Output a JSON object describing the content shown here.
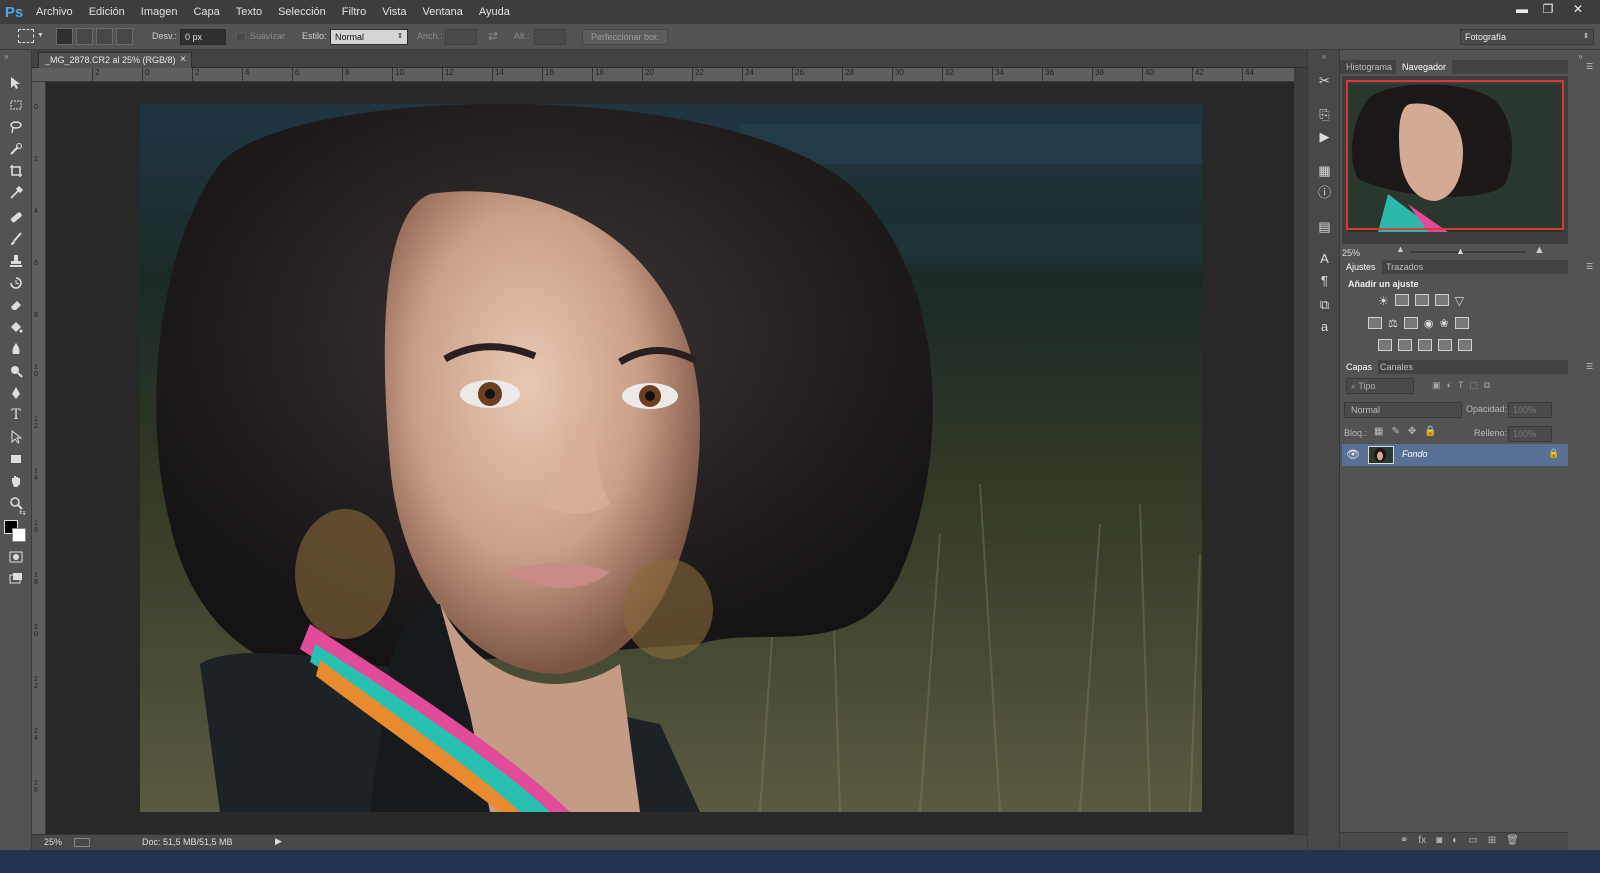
{
  "app": {
    "logo": "Ps"
  },
  "menu": [
    "Archivo",
    "Edición",
    "Imagen",
    "Capa",
    "Texto",
    "Selección",
    "Filtro",
    "Vista",
    "Ventana",
    "Ayuda"
  ],
  "window_controls": {
    "minimize": "▬",
    "restore": "❐",
    "close": "✕"
  },
  "options_bar": {
    "desvan_label": "Desv.:",
    "desvan_value": "0 px",
    "suavizar_label": "Suavizar",
    "estilo_label": "Estilo:",
    "estilo_value": "Normal",
    "anch_label": "Anch.:",
    "alt_label": "Alt.:",
    "refine_button": "Perfeccionar bor.",
    "workspace": "Fotografía"
  },
  "document": {
    "tab_title": "_MG_2878.CR2 al 25% (RGB/8)",
    "close_glyph": "×",
    "zoom": "25%",
    "doc_info": "Doc: 51,5 MB/51,5 MB"
  },
  "ruler_top_labels": [
    "2",
    "0",
    "2",
    "4",
    "6",
    "8",
    "10",
    "12",
    "14",
    "16",
    "18",
    "20",
    "22",
    "24",
    "26",
    "28",
    "30",
    "32",
    "34",
    "36",
    "38",
    "40",
    "42",
    "44"
  ],
  "ruler_left_labels": [
    "0",
    "2",
    "4",
    "6",
    "8",
    "1 0",
    "1 2",
    "1 4",
    "1 6",
    "1 8",
    "2 0",
    "2 2",
    "2 4",
    "2 6"
  ],
  "panels": {
    "top_tabs": [
      "Histograma",
      "Navegador"
    ],
    "nav_zoom": "25%",
    "adjust_tabs": [
      "Ajustes",
      "Trazados"
    ],
    "adjust_heading": "Añadir un ajuste",
    "layers_tabs": [
      "Capas",
      "Canales"
    ],
    "kind_filter": "Tipo",
    "blend_mode": "Normal",
    "opacity_label": "Opacidad:",
    "opacity_value": "100%",
    "lock_label": "Bloq.:",
    "fill_label": "Relleno:",
    "fill_value": "100%",
    "layer_name": "Fondo"
  },
  "colors": {
    "highlight_border": "#d83a3a",
    "layer_selected": "#587093",
    "logo": "#4fa6e8"
  }
}
